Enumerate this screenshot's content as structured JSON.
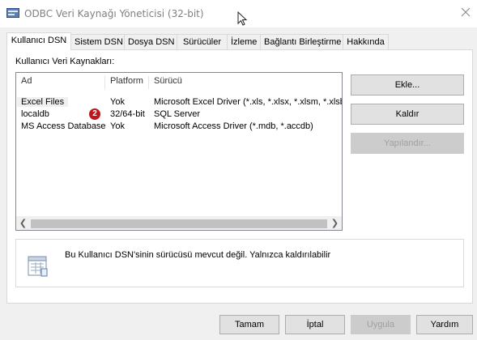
{
  "window": {
    "title": "ODBC Veri Kaynağı Yöneticisi (32-bit)",
    "icon": "odbc-app-icon",
    "close_icon": "close-icon"
  },
  "tabs": [
    {
      "label": "Kullanıcı DSN",
      "active": true
    },
    {
      "label": "Sistem DSN",
      "active": false
    },
    {
      "label": "Dosya DSN",
      "active": false
    },
    {
      "label": "Sürücüler",
      "active": false
    },
    {
      "label": "İzleme",
      "active": false
    },
    {
      "label": "Bağlantı Birleştirme",
      "active": false
    },
    {
      "label": "Hakkında",
      "active": false
    }
  ],
  "panel": {
    "section_label": "Kullanıcı Veri Kaynakları:",
    "columns": [
      "Ad",
      "Platform",
      "Sürücü"
    ],
    "rows": [
      {
        "name": "Excel Files",
        "platform": "Yok",
        "driver": "Microsoft Excel Driver (*.xls, *.xlsx, *.xlsm, *.xlsb"
      },
      {
        "name": "localdb",
        "platform": "32/64-bit",
        "driver": "SQL Server"
      },
      {
        "name": "MS Access Database",
        "platform": "Yok",
        "driver": "Microsoft Access Driver (*.mdb, *.accdb)"
      }
    ],
    "badge": "2",
    "buttons": {
      "add": "Ekle...",
      "remove": "Kaldır",
      "configure": "Yapılandır..."
    },
    "info_text": "Bu Kullanıcı DSN'sinin sürücüsü mevcut değil. Yalnızca kaldırılabilir"
  },
  "footer": {
    "ok": "Tamam",
    "cancel": "İptal",
    "apply": "Uygula",
    "help": "Yardım"
  },
  "colors": {
    "dialog_bg": "#f0f0f0",
    "badge": "#c0151a",
    "disabled_text": "#a0a0a0"
  }
}
